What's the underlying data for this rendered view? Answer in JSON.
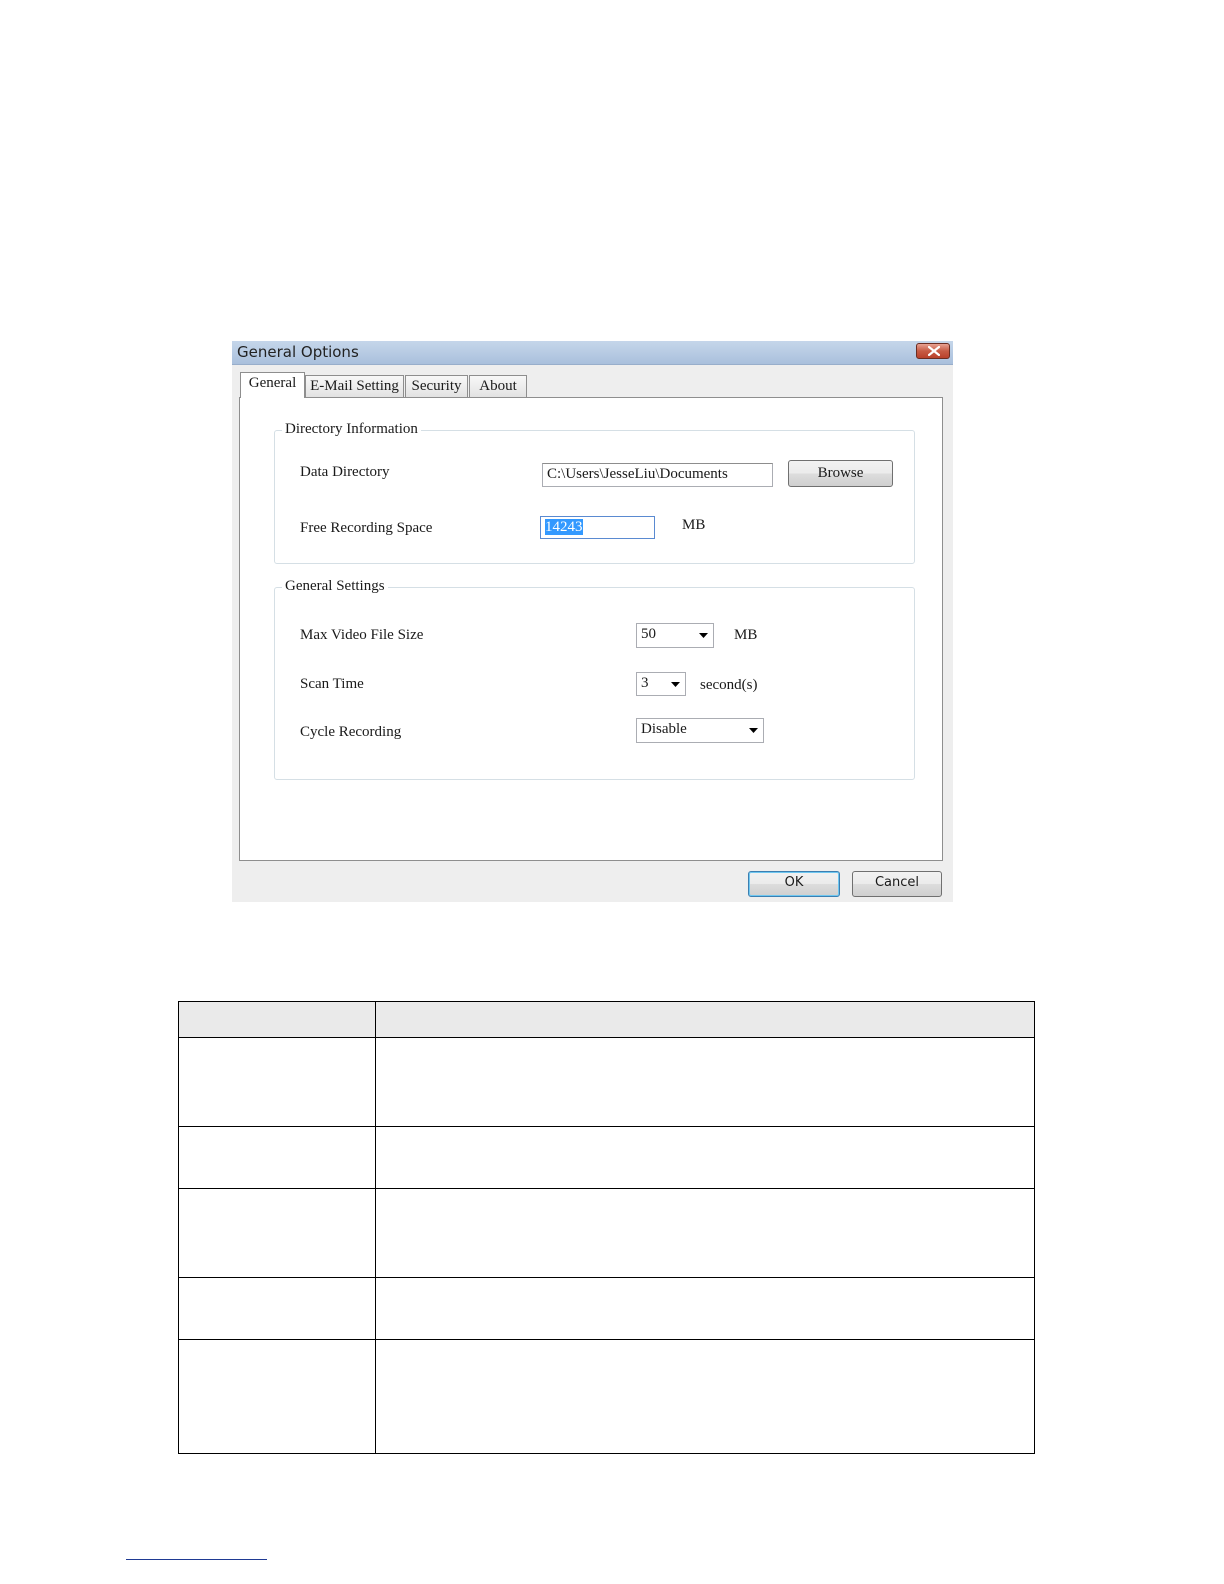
{
  "dialog": {
    "title": "General Options",
    "tabs": [
      {
        "label": "General",
        "active": true
      },
      {
        "label": "E-Mail Setting",
        "active": false
      },
      {
        "label": "Security",
        "active": false
      },
      {
        "label": "About",
        "active": false
      }
    ],
    "directory_group": {
      "legend": "Directory Information",
      "data_directory_label": "Data Directory",
      "data_directory_value": "C:\\Users\\JesseLiu\\Documents",
      "browse_label": "Browse",
      "free_space_label": "Free Recording Space",
      "free_space_value": "14243",
      "free_space_unit": "MB"
    },
    "settings_group": {
      "legend": "General Settings",
      "max_file_size_label": "Max Video File Size",
      "max_file_size_value": "50",
      "max_file_size_unit": "MB",
      "scan_time_label": "Scan Time",
      "scan_time_value": "3",
      "scan_time_unit": "second(s)",
      "cycle_recording_label": "Cycle Recording",
      "cycle_recording_value": "Disable"
    },
    "ok_label": "OK",
    "cancel_label": "Cancel"
  },
  "table": {
    "header": [
      "",
      ""
    ],
    "rows": [
      [
        "",
        ""
      ],
      [
        "",
        ""
      ],
      [
        "",
        ""
      ],
      [
        "",
        ""
      ],
      [
        "",
        ""
      ]
    ]
  }
}
